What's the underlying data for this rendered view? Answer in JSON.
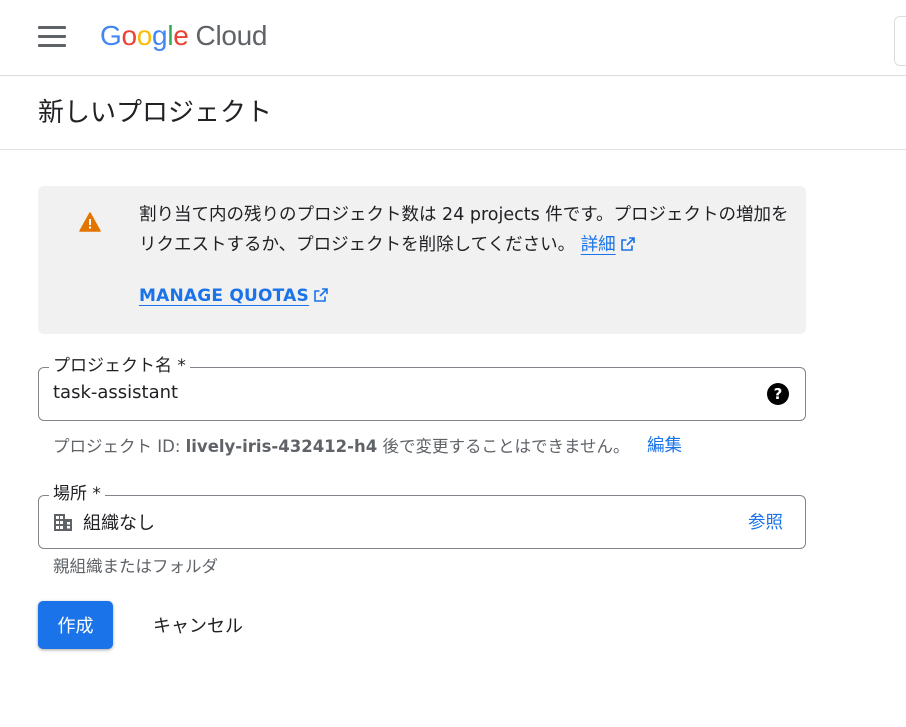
{
  "header": {
    "logo_google_letters": [
      "G",
      "o",
      "o",
      "g",
      "l",
      "e"
    ],
    "logo_product": "Cloud"
  },
  "page": {
    "title": "新しいプロジェクト"
  },
  "quota_notice": {
    "text": "割り当て内の残りのプロジェクト数は 24 projects 件です。プロジェクトの増加をリクエストするか、プロジェクトを削除してください。",
    "details_link": "詳細",
    "manage_quotas_link": "MANAGE QUOTAS",
    "warning_color": "#e37400"
  },
  "project_name": {
    "label": "プロジェクト名 *",
    "value": "task-assistant",
    "help_icon": "?"
  },
  "project_id": {
    "prefix": "プロジェクト ID: ",
    "id": "lively-iris-432412-h4",
    "suffix": " 後で変更することはできません。",
    "edit_link": "編集"
  },
  "location": {
    "label": "場所 *",
    "value": "組織なし",
    "browse_link": "参照",
    "hint": "親組織またはフォルダ"
  },
  "actions": {
    "create_label": "作成",
    "cancel_label": "キャンセル"
  },
  "colors": {
    "accent": "#1a73e8",
    "notice_bg": "#f1f1f1"
  }
}
